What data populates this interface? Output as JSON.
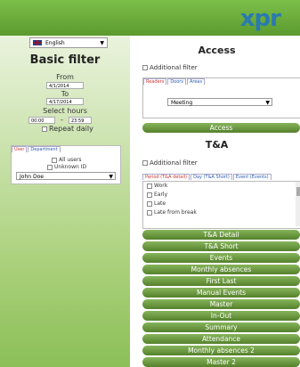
{
  "logo": {
    "text_main": "xpr"
  },
  "sidebar": {
    "language": "English",
    "title": "Basic filter",
    "from_label": "From",
    "from_value": "4/1/2014",
    "to_label": "To",
    "to_value": "4/17/2014",
    "select_hours_label": "Select hours",
    "hour_from": "00:00",
    "hour_sep": "-",
    "hour_to": "23:59",
    "repeat_daily_label": "Repeat daily",
    "tabs": [
      "User",
      "Department"
    ],
    "all_users_label": "All users",
    "unknown_id_label": "Unknown ID",
    "user_select": "John Doe"
  },
  "access": {
    "title": "Access",
    "additional_filter": "Additional filter",
    "tabs": [
      "Readers",
      "Doors",
      "Areas"
    ],
    "selected": "Meeting",
    "button": "Access"
  },
  "ta": {
    "title": "T&A",
    "additional_filter": "Additional filter",
    "tabs": [
      "Period (T&A detail)",
      "Day (T&A Short)",
      "Event (Events)"
    ],
    "items": [
      "Work",
      "Early",
      "Late",
      "Late from break"
    ],
    "buttons": [
      "T&A Detail",
      "T&A Short",
      "Events",
      "Monthly absences",
      "First Last",
      "Manual Events",
      "Master",
      "In-Out",
      "Summary",
      "Attendance",
      "Monthly absences 2",
      "Master 2"
    ]
  }
}
